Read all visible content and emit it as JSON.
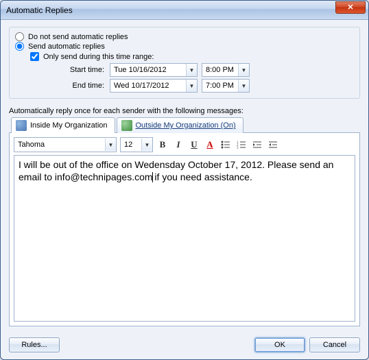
{
  "window": {
    "title": "Automatic Replies"
  },
  "options": {
    "dont_send": "Do not send automatic replies",
    "send": "Send automatic replies",
    "only_range": "Only send during this time range:",
    "start_label": "Start time:",
    "start_date": "Tue 10/16/2012",
    "start_time": "8:00 PM",
    "end_label": "End time:",
    "end_date": "Wed 10/17/2012",
    "end_time": "7:00 PM",
    "selected": "send",
    "only_range_checked": true
  },
  "section_label": "Automatically reply once for each sender with the following messages:",
  "tabs": {
    "inside": "Inside My Organization",
    "outside": "Outside My Organization (On)",
    "active": "inside"
  },
  "editor": {
    "font": "Tahoma",
    "size": "12",
    "body_before": "I will be out of the office on Wedensday October 17, 2012. Please send an email to info@technipages.com",
    "body_after": " if you need assistance."
  },
  "footer": {
    "rules": "Rules...",
    "ok": "OK",
    "cancel": "Cancel"
  },
  "colors": {
    "accent": "#3c6fb5"
  }
}
